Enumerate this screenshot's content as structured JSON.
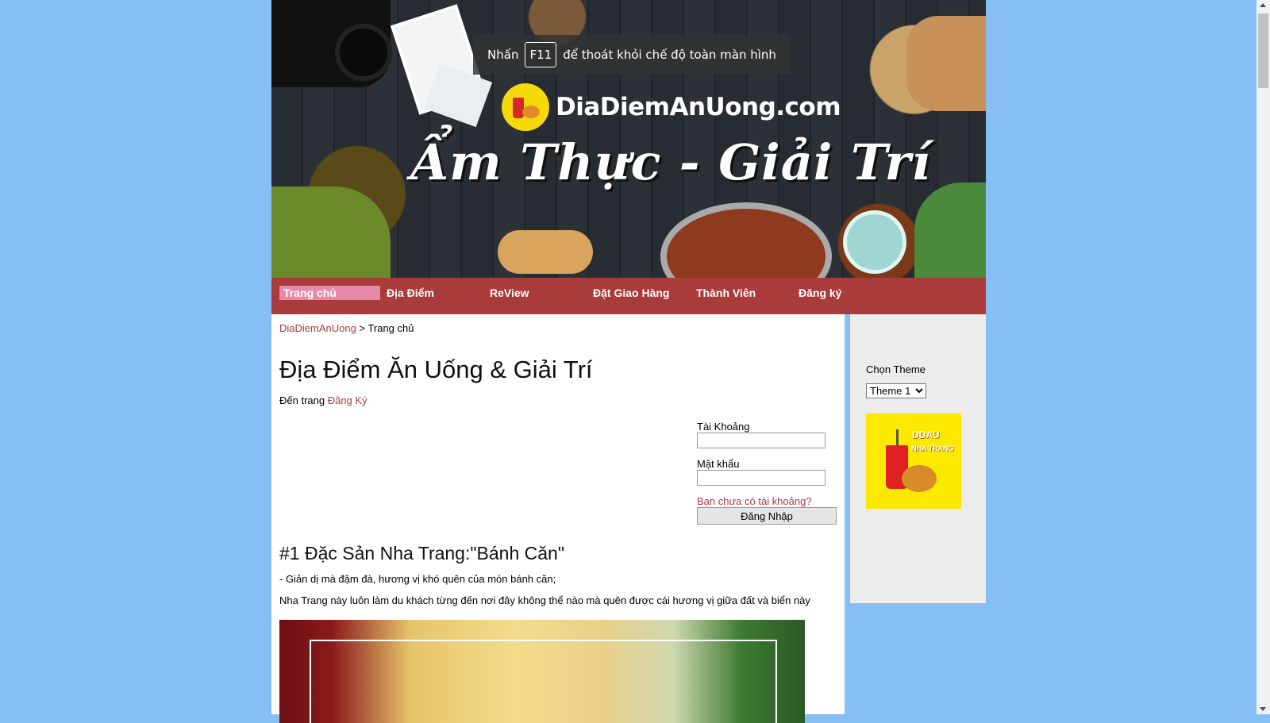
{
  "banner": {
    "site_name": "DiaDiemAnUong.com",
    "tagline": "Ẩm Thực - Giải Trí"
  },
  "fullscreen_toast": {
    "before": "Nhấn",
    "key": "F11",
    "after": "để thoát khỏi chế độ toàn màn hình"
  },
  "nav": {
    "items": [
      {
        "label": "Trang chủ"
      },
      {
        "label": "Địa Điểm"
      },
      {
        "label": "ReView"
      },
      {
        "label": "Đặt Giao Hàng"
      },
      {
        "label": "Thành Viên"
      },
      {
        "label": "Đăng ký"
      }
    ]
  },
  "breadcrumb": {
    "root": "DiaDiemAnUong",
    "separator": " > ",
    "current": "Trang chủ"
  },
  "main": {
    "title": "Địa Điểm Ăn Uống & Giải Trí",
    "goto_prefix": "Đến trang ",
    "goto_link": "Đăng Ký",
    "article_title": "#1 Đặc Sản Nha Trang:\"Bánh Căn\"",
    "paragraph1": "- Giản dị mà đậm đà, hương vị khó quên của món bánh căn;",
    "paragraph2": "Nha Trang này luôn làm du khách từng đến nơi đây không thể nào mà quên được cái hương vị giữa đất và biển này"
  },
  "login": {
    "username_label": "Tài Khoảng",
    "username_value": "",
    "password_label": "Mật khẩu",
    "password_value": "",
    "signup_link": "Bạn chưa có tài khoảng?",
    "submit_label": "Đăng Nhập"
  },
  "sidebar": {
    "theme_label": "Chọn Theme",
    "theme_selected": "Theme 1",
    "logo_text_1": "DDAU",
    "logo_text_2": "NHA TRANG"
  },
  "colors": {
    "nav_bg": "#a93b3b",
    "nav_active": "#e48aa8",
    "page_bg": "#87bff5",
    "link": "#a93b3b"
  }
}
